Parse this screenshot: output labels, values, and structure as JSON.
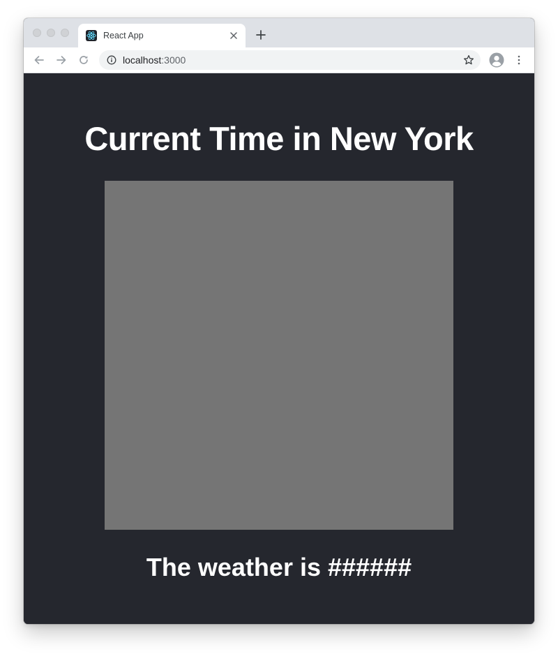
{
  "browser": {
    "tab": {
      "title": "React App",
      "favicon": "react-logo-icon"
    },
    "address_bar": {
      "host": "localhost",
      "port": ":3000"
    },
    "icons": {
      "back": "arrow-left-icon",
      "forward": "arrow-right-icon",
      "reload": "reload-icon",
      "info": "info-icon",
      "bookmark": "star-icon",
      "profile": "account-circle-icon",
      "menu": "more-vertical-icon",
      "close_tab": "close-icon",
      "new_tab": "plus-icon"
    }
  },
  "page": {
    "heading": "Current Time in New York",
    "weather_text": "The weather is ######",
    "colors": {
      "background": "#25272e",
      "placeholder": "#757575",
      "text": "#ffffff"
    }
  }
}
